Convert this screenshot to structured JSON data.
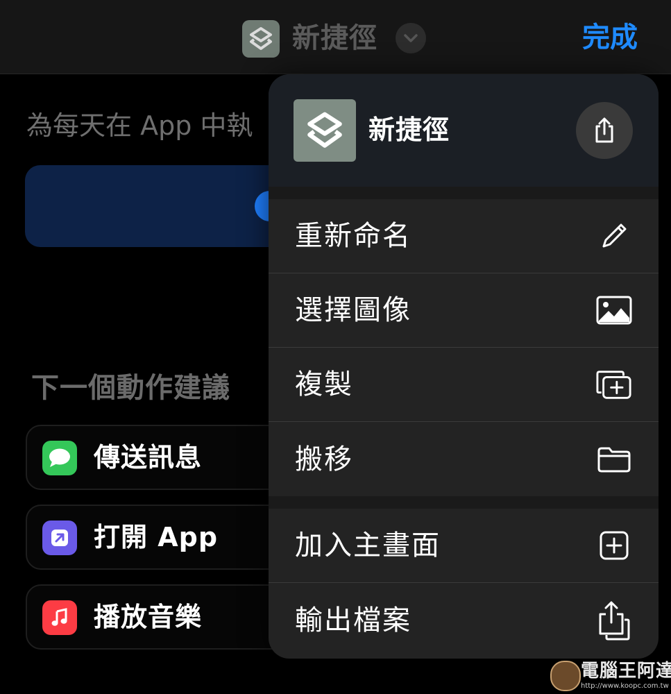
{
  "nav": {
    "title": "新捷徑",
    "done_label": "完成"
  },
  "background": {
    "description": "為每天在 App 中執",
    "section_title": "下一個動作建議",
    "suggestions": [
      {
        "label": "傳送訊息",
        "icon": "messages-icon",
        "color": "#34c759"
      },
      {
        "label": "打開 App",
        "icon": "open-app-icon",
        "color": "#6a5ae8"
      },
      {
        "label": "播放音樂",
        "icon": "music-icon",
        "color": "#fc3c44"
      }
    ]
  },
  "menu": {
    "app_name": "新捷徑",
    "share_icon": "share-icon",
    "items": [
      {
        "label": "重新命名",
        "icon": "pencil-icon"
      },
      {
        "label": "選擇圖像",
        "icon": "photo-icon"
      },
      {
        "label": "複製",
        "icon": "duplicate-icon"
      },
      {
        "label": "搬移",
        "icon": "folder-icon"
      },
      {
        "label": "加入主畫面",
        "icon": "add-square-icon"
      },
      {
        "label": "輸出檔案",
        "icon": "export-file-icon"
      }
    ]
  },
  "colors": {
    "accent": "#1f8bff",
    "menu_bg": "#232323",
    "shortcut_icon_bg": "#7f8d84"
  },
  "watermark": {
    "text": "電腦王阿達",
    "url": "http://www.koopc.com.tw"
  }
}
